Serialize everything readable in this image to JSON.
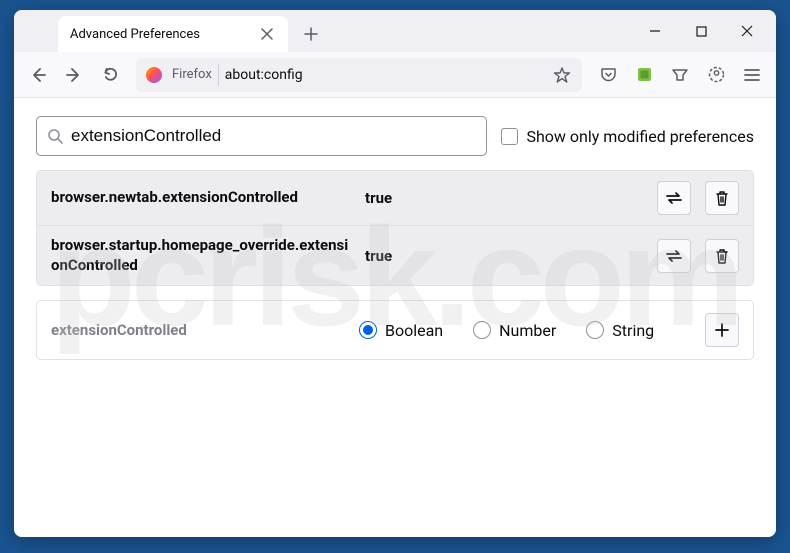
{
  "window": {
    "tab_title": "Advanced Preferences",
    "url_label": "Firefox",
    "url": "about:config"
  },
  "search": {
    "value": "extensionControlled",
    "checkbox_label": "Show only modified preferences"
  },
  "prefs": {
    "rows": [
      {
        "name": "browser.newtab.extensionControlled",
        "value": "true"
      },
      {
        "name": "browser.startup.homepage_override.extensionControlled",
        "value": "true"
      }
    ]
  },
  "add_row": {
    "name": "extensionControlled",
    "types": [
      "Boolean",
      "Number",
      "String"
    ],
    "selected": "Boolean"
  },
  "watermark": "pcrisk.com"
}
